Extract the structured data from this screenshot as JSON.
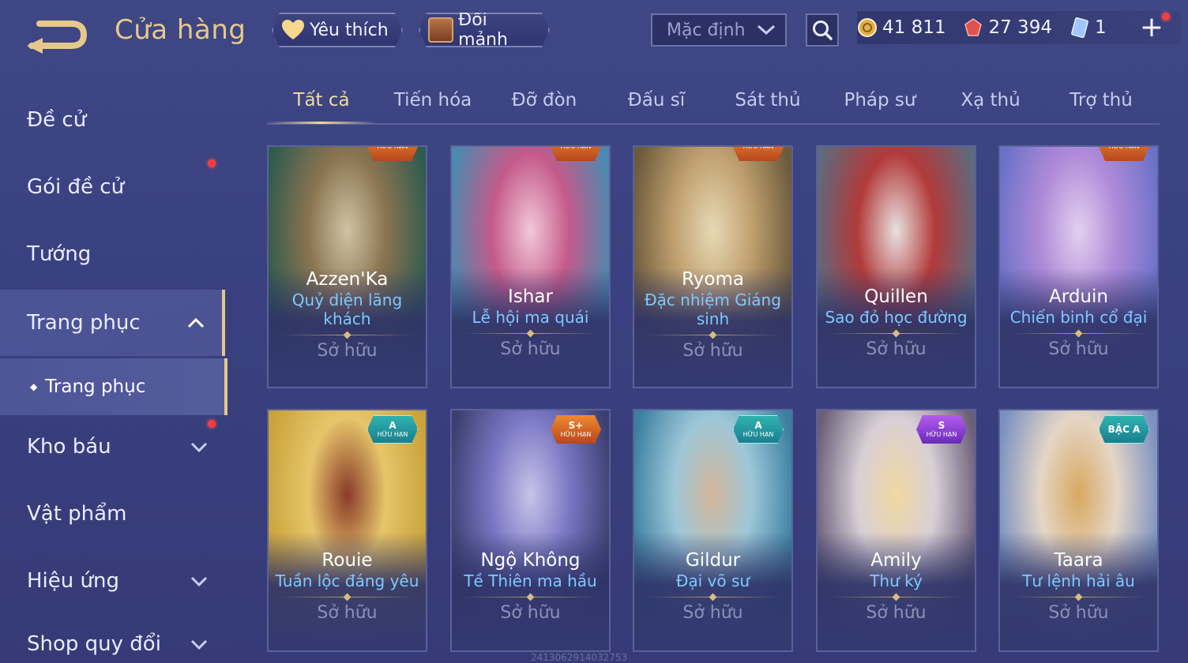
{
  "header": {
    "title": "Cửa hàng",
    "favorite_label": "Yêu thích",
    "exchange_label": "Đổi mảnh",
    "sort_value": "Mặc định",
    "currencies": [
      {
        "icon": "gold-coin-icon",
        "value": "41 811"
      },
      {
        "icon": "red-gem-icon",
        "value": "27 394"
      },
      {
        "icon": "voucher-card-icon",
        "value": "1"
      }
    ],
    "add_symbol": "+"
  },
  "sidebar": {
    "items": [
      {
        "label": "Đề cử"
      },
      {
        "label": "Gói đề cử"
      },
      {
        "label": "Tướng"
      },
      {
        "label": "Trang phục"
      },
      {
        "label": "Kho báu"
      },
      {
        "label": "Vật phẩm"
      },
      {
        "label": "Hiệu ứng"
      },
      {
        "label": "Shop quy đổi"
      }
    ],
    "sub_item": "Trang phục"
  },
  "tabs": [
    "Tất cả",
    "Tiến hóa",
    "Đỡ đòn",
    "Đấu sĩ",
    "Sát thủ",
    "Pháp sư",
    "Xạ thủ",
    "Trợ thủ"
  ],
  "cards": [
    {
      "hero": "Azzen'Ka",
      "skin": "Quỷ diện lãng khách",
      "status": "Sở hữu",
      "badge_tier": "",
      "badge_text": "HỮU HẠN",
      "art": [
        "#2f5b4f",
        "#8a7450",
        "#cfc3a3"
      ]
    },
    {
      "hero": "Ishar",
      "skin": "Lễ hội ma quái",
      "status": "Sở hữu",
      "badge_tier": "",
      "badge_text": "HỮU HẠN",
      "art": [
        "#4a8ab0",
        "#c45a8a",
        "#f1c8d8"
      ]
    },
    {
      "hero": "Ryoma",
      "skin": "Đặc nhiệm Giáng sinh",
      "status": "Sở hữu",
      "badge_tier": "",
      "badge_text": "HỮU HẠN",
      "art": [
        "#6b5a3b",
        "#c0a070",
        "#e7d9b4"
      ]
    },
    {
      "hero": "Quillen",
      "skin": "Sao đỏ học đường",
      "status": "Sở hữu",
      "badge_tier": "",
      "badge_text": "",
      "art": [
        "#5e6a7e",
        "#b23a3a",
        "#e8e2e0"
      ]
    },
    {
      "hero": "Arduin",
      "skin": "Chiến binh cổ đại",
      "status": "Sở hữu",
      "badge_tier": "",
      "badge_text": "HỮU HẠN",
      "art": [
        "#6a72c8",
        "#b08ad8",
        "#e2d0ef"
      ]
    },
    {
      "hero": "Rouie",
      "skin": "Tuần lộc đáng yêu",
      "status": "Sở hữu",
      "badge_tier": "A",
      "badge_text": "HỮU HẠN",
      "art": [
        "#c9a23a",
        "#e6c56a",
        "#8a3a2a"
      ]
    },
    {
      "hero": "Ngộ Không",
      "skin": "Tề Thiên ma hầu",
      "status": "Sở hữu",
      "badge_tier": "S+",
      "badge_text": "HỮU HẠN",
      "art": [
        "#3b3f70",
        "#7b78c4",
        "#c7c3e8"
      ]
    },
    {
      "hero": "Gildur",
      "skin": "Đại võ sư",
      "status": "Sở hữu",
      "badge_tier": "A",
      "badge_text": "HỮU HẠN",
      "art": [
        "#3b7fa0",
        "#9dc7d8",
        "#d4b79a"
      ]
    },
    {
      "hero": "Amily",
      "skin": "Thư ký",
      "status": "Sở hữu",
      "badge_tier": "S",
      "badge_text": "HỮU HẠN",
      "art": [
        "#6a5e78",
        "#d8cfd6",
        "#f0d8a0"
      ]
    },
    {
      "hero": "Taara",
      "skin": "Tư lệnh hải âu",
      "status": "Sở hữu",
      "badge_tier": "BẬC A",
      "badge_text": "",
      "art": [
        "#7a90c0",
        "#e4d6c6",
        "#d8a860"
      ]
    }
  ],
  "watermark": "2413062914032753",
  "colors": {
    "accent_gold": "#e6c98a",
    "skin_blue": "#7ec8ff",
    "badge_teal": "#2fb3b0",
    "badge_orange": "#f08a2e",
    "badge_purple": "#b35cf0"
  }
}
